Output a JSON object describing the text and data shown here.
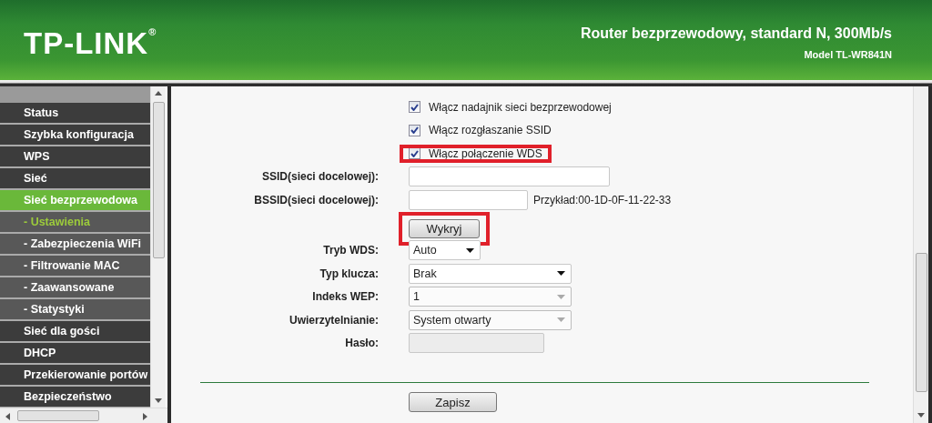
{
  "header": {
    "logo": "TP-LINK$^{®}$",
    "title": "Router bezprzewodowy, standard N, 300Mb/s",
    "model": "Model TL-WR841N"
  },
  "sidebar": {
    "items": [
      {
        "label": "Status",
        "kind": "main",
        "selected": false
      },
      {
        "label": "Szybka konfiguracja",
        "kind": "main",
        "selected": false
      },
      {
        "label": "WPS",
        "kind": "main",
        "selected": false
      },
      {
        "label": "Sieć",
        "kind": "main",
        "selected": false
      },
      {
        "label": "Sieć bezprzewodowa",
        "kind": "main",
        "selected": true
      },
      {
        "label": "- Ustawienia",
        "kind": "sub",
        "selected": true
      },
      {
        "label": "- Zabezpieczenia WiFi",
        "kind": "sub",
        "selected": false
      },
      {
        "label": "- Filtrowanie MAC",
        "kind": "sub",
        "selected": false
      },
      {
        "label": "- Zaawansowane",
        "kind": "sub",
        "selected": false
      },
      {
        "label": "- Statystyki",
        "kind": "sub",
        "selected": false
      },
      {
        "label": "Sieć dla gości",
        "kind": "main",
        "selected": false
      },
      {
        "label": "DHCP",
        "kind": "main",
        "selected": false
      },
      {
        "label": "Przekierowanie portów",
        "kind": "main",
        "selected": false
      },
      {
        "label": "Bezpieczeństwo",
        "kind": "main",
        "selected": false
      }
    ]
  },
  "form": {
    "rows": [
      {
        "kind": "checkbox",
        "text": "Włącz nadajnik sieci bezprzewodowej",
        "checked": true,
        "highlighted": false
      },
      {
        "kind": "checkbox",
        "text": "Włącz rozgłaszanie SSID",
        "checked": true,
        "highlighted": false
      },
      {
        "kind": "checkbox",
        "text": "Włącz połączenie WDS",
        "checked": true,
        "highlighted": true
      },
      {
        "kind": "input",
        "label": "SSID(sieci docelowej):",
        "disabled": false
      },
      {
        "kind": "input",
        "label": "BSSID(sieci docelowej):",
        "disabled": false,
        "hint": "Przykład:00-1D-0F-11-22-33"
      },
      {
        "kind": "button",
        "text": "Wykryj",
        "highlighted": true
      },
      {
        "kind": "select",
        "label": "Tryb WDS:",
        "value": "Auto",
        "disabled": false
      },
      {
        "kind": "select",
        "label": "Typ klucza:",
        "value": "Brak",
        "disabled": false
      },
      {
        "kind": "select",
        "label": "Indeks WEP:",
        "value": "1",
        "disabled": true
      },
      {
        "kind": "select",
        "label": "Uwierzytelnianie:",
        "value": "System otwarty",
        "disabled": true
      },
      {
        "kind": "input",
        "label": "Hasło:",
        "disabled": true
      }
    ]
  },
  "save_button": "Zapisz"
}
